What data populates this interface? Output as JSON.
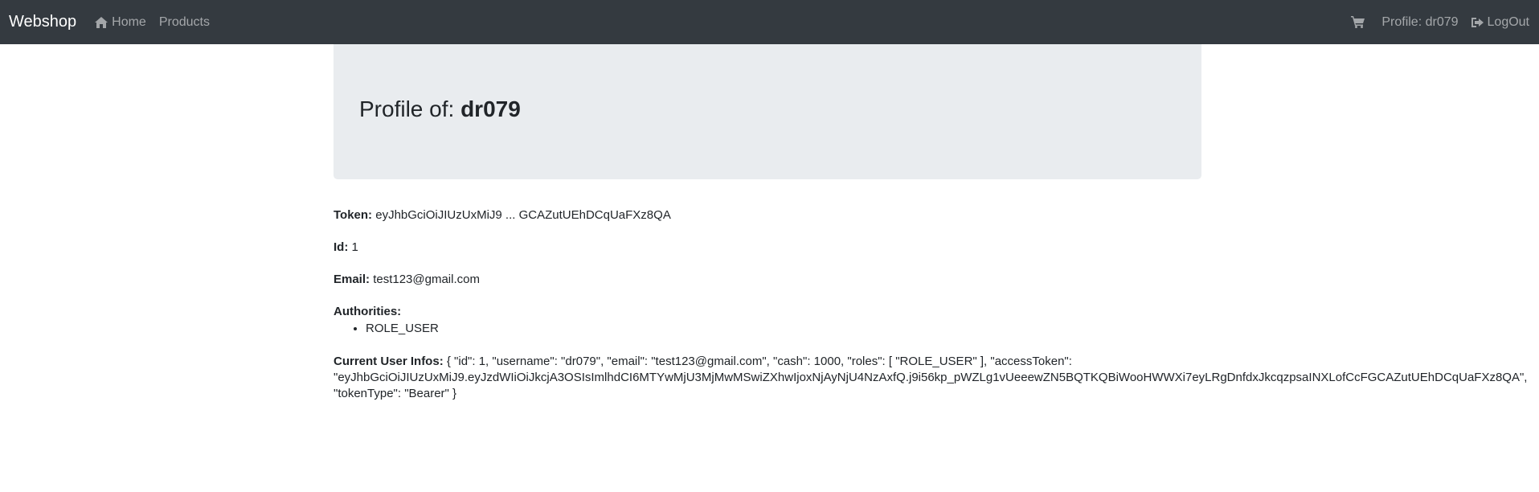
{
  "navbar": {
    "brand": "Webshop",
    "home_label": "Home",
    "home_icon": "home-icon",
    "products_label": "Products",
    "cart_icon": "shopping-cart-icon",
    "profile_label": "Profile: dr079",
    "logout_label": "LogOut",
    "logout_icon": "sign-out-icon",
    "background": "#343a40"
  },
  "jumbotron": {
    "title_prefix": "Profile of:",
    "username": "dr079",
    "background": "#e9ecef"
  },
  "profile": {
    "token_label": "Token:",
    "token_value": "eyJhbGciOiJIUzUxMiJ9 ... GCAZutUEhDCqUaFXz8QA",
    "id_label": "Id:",
    "id_value": "1",
    "email_label": "Email:",
    "email_value": "test123@gmail.com",
    "authorities_label": "Authorities:",
    "authorities": [
      "ROLE_USER"
    ],
    "current_user_label": "Current User Infos:",
    "current_user_line1": "{ \"id\": 1, \"username\": \"dr079\", \"email\": \"test123@gmail.com\", \"cash\": 1000, \"roles\": [ \"ROLE_USER\" ], \"accessToken\":",
    "current_user_line2": "\"eyJhbGciOiJIUzUxMiJ9.eyJzdWIiOiJkcjA3OSIsImlhdCI6MTYwMjU3MjMwMSwiZXhwIjoxNjAyNjU4NzAxfQ.j9i56kp_pWZLg1vUeeewZN5BQTKQBiWooHWWXi7eyLRgDnfdxJkcqzpsaINXLofCcFGCAZutUEhDCqUaFXz8QA\",",
    "current_user_line3": "\"tokenType\": \"Bearer\" }"
  }
}
